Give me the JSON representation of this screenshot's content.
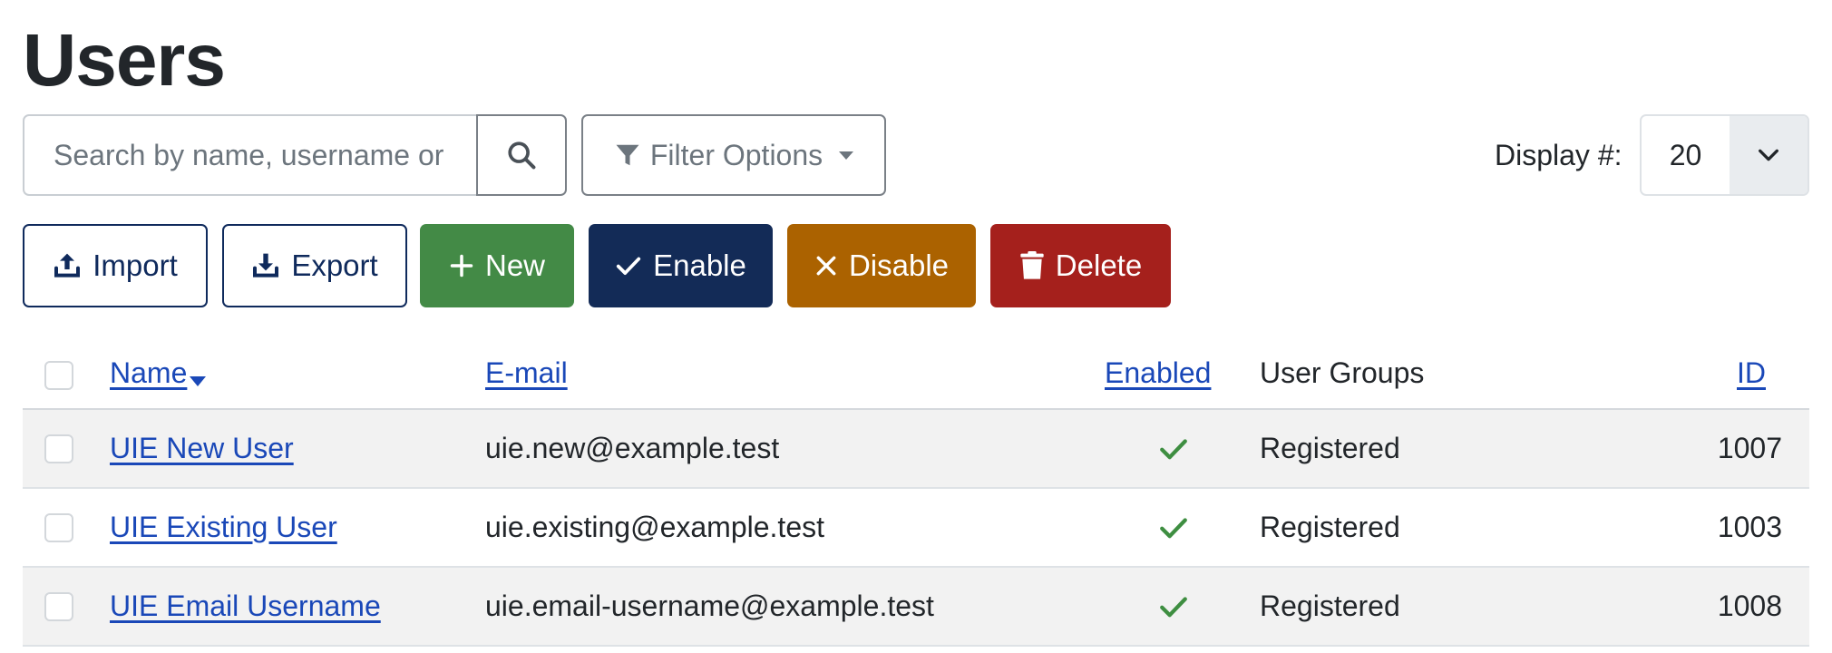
{
  "page": {
    "title": "Users"
  },
  "search": {
    "placeholder": "Search by name, username or"
  },
  "filter": {
    "label": "Filter Options"
  },
  "display": {
    "label": "Display #:",
    "value": "20"
  },
  "toolbar": {
    "import_label": "Import",
    "export_label": "Export",
    "new_label": "New",
    "enable_label": "Enable",
    "disable_label": "Disable",
    "delete_label": "Delete"
  },
  "table": {
    "headers": {
      "name": "Name",
      "email": "E-mail",
      "enabled": "Enabled",
      "groups": "User Groups",
      "id": "ID"
    },
    "rows": [
      {
        "name": "UIE New User",
        "email": "uie.new@example.test",
        "enabled": true,
        "groups": "Registered",
        "id": "1007"
      },
      {
        "name": "UIE Existing User",
        "email": "uie.existing@example.test",
        "enabled": true,
        "groups": "Registered",
        "id": "1003"
      },
      {
        "name": "UIE Email Username",
        "email": "uie.email-username@example.test",
        "enabled": true,
        "groups": "Registered",
        "id": "1008"
      }
    ]
  },
  "colors": {
    "link": "#1a48b8",
    "new": "#438a46",
    "enable": "#132b57",
    "disable": "#ab6200",
    "delete": "#a5201c",
    "check": "#3e8e41"
  },
  "icons": {
    "search": "search-icon",
    "filter": "filter-icon",
    "import": "upload-icon",
    "export": "download-icon",
    "new": "plus-icon",
    "enable": "check-icon",
    "disable": "x-icon",
    "delete": "trash-icon"
  }
}
